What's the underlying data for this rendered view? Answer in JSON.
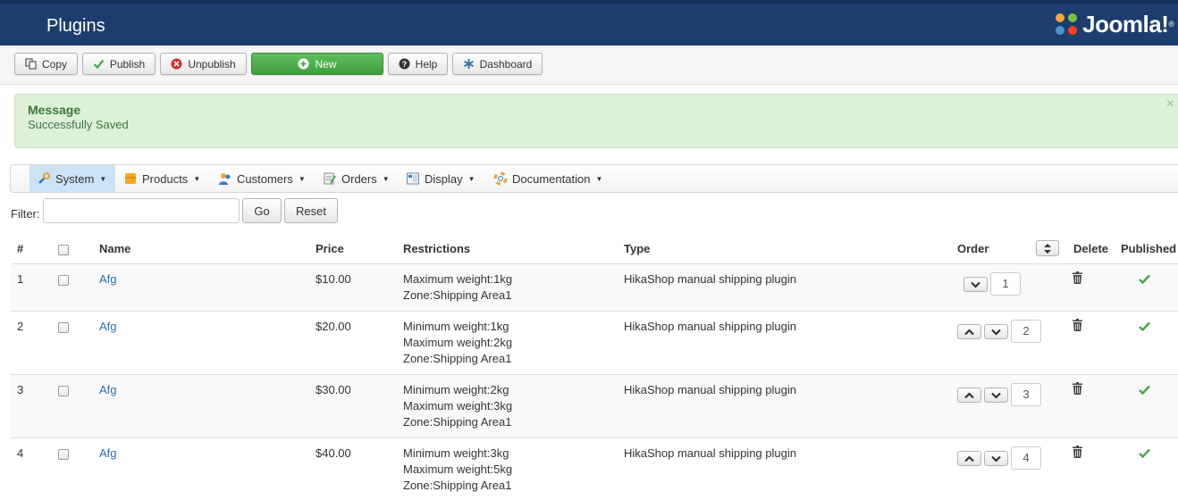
{
  "header": {
    "title": "Plugins",
    "logo_text": "Joomla!",
    "logo_mark": "®"
  },
  "toolbar": {
    "copy": "Copy",
    "publish": "Publish",
    "unpublish": "Unpublish",
    "new": "New",
    "help": "Help",
    "dashboard": "Dashboard"
  },
  "message": {
    "heading": "Message",
    "text": "Successfully Saved",
    "close": "×"
  },
  "menu": {
    "items": [
      {
        "label": "System",
        "icon": "wrench-icon",
        "active": true
      },
      {
        "label": "Products",
        "icon": "box-icon"
      },
      {
        "label": "Customers",
        "icon": "users-icon"
      },
      {
        "label": "Orders",
        "icon": "orders-icon"
      },
      {
        "label": "Display",
        "icon": "display-icon"
      },
      {
        "label": "Documentation",
        "icon": "lifebuoy-icon"
      }
    ],
    "caret": "▼"
  },
  "filter": {
    "label": "Filter:",
    "value": "",
    "go": "Go",
    "reset": "Reset"
  },
  "table": {
    "columns": {
      "num": "#",
      "name": "Name",
      "price": "Price",
      "restrictions": "Restrictions",
      "type": "Type",
      "order": "Order",
      "delete": "Delete",
      "published": "Published"
    },
    "rows": [
      {
        "num": "1",
        "name": "Afg",
        "price": "$10.00",
        "restrictions": [
          "Maximum weight:1kg",
          "Zone:Shipping Area1"
        ],
        "type": "HikaShop manual shipping plugin",
        "order": "1",
        "published": true
      },
      {
        "num": "2",
        "name": "Afg",
        "price": "$20.00",
        "restrictions": [
          "Minimum weight:1kg",
          "Maximum weight:2kg",
          "Zone:Shipping Area1"
        ],
        "type": "HikaShop manual shipping plugin",
        "order": "2",
        "published": true
      },
      {
        "num": "3",
        "name": "Afg",
        "price": "$30.00",
        "restrictions": [
          "Minimum weight:2kg",
          "Maximum weight:3kg",
          "Zone:Shipping Area1"
        ],
        "type": "HikaShop manual shipping plugin",
        "order": "3",
        "published": true
      },
      {
        "num": "4",
        "name": "Afg",
        "price": "$40.00",
        "restrictions": [
          "Minimum weight:3kg",
          "Maximum weight:5kg",
          "Zone:Shipping Area1"
        ],
        "type": "HikaShop manual shipping plugin",
        "order": "4",
        "published": true
      }
    ]
  },
  "colors": {
    "header_bg": "#1c3d6e",
    "new_button": "#47a447",
    "message_bg": "#dff0d8",
    "message_text": "#3c763d",
    "link": "#2a6fa8",
    "published_check": "#46a546",
    "menu_active": "#cbe3f5"
  }
}
